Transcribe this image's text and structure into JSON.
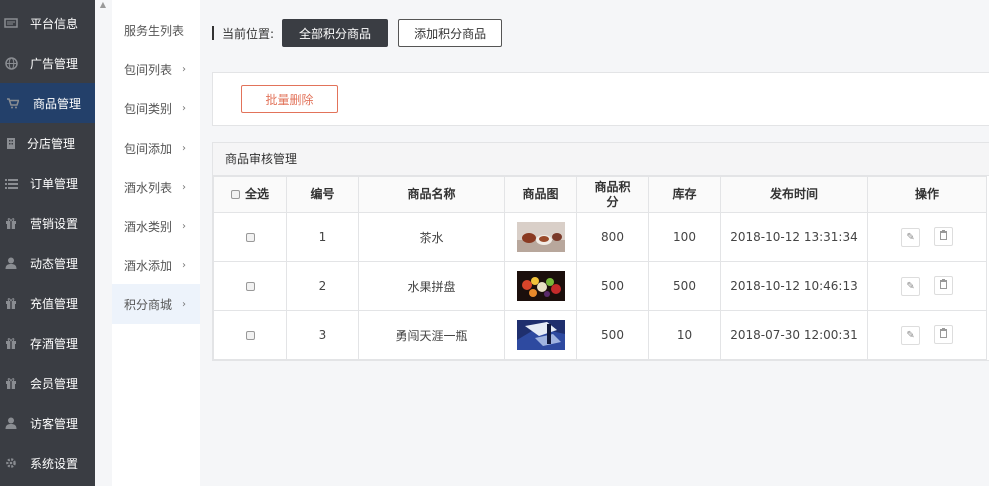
{
  "sidebar": {
    "items": [
      {
        "label": "平台信息",
        "icon": "info-panel-icon"
      },
      {
        "label": "广告管理",
        "icon": "globe-icon"
      },
      {
        "label": "商品管理",
        "icon": "cart-icon",
        "active": true
      },
      {
        "label": "分店管理",
        "icon": "building-icon"
      },
      {
        "label": "订单管理",
        "icon": "list-icon"
      },
      {
        "label": "营销设置",
        "icon": "gift-icon"
      },
      {
        "label": "动态管理",
        "icon": "user-icon"
      },
      {
        "label": "充值管理",
        "icon": "gift-icon"
      },
      {
        "label": "存酒管理",
        "icon": "gift-icon"
      },
      {
        "label": "会员管理",
        "icon": "gift-icon"
      },
      {
        "label": "访客管理",
        "icon": "user-icon"
      },
      {
        "label": "系统设置",
        "icon": "gear-icon"
      }
    ],
    "active_color": "#23406a"
  },
  "submenu": {
    "items": [
      {
        "label": "服务生列表",
        "chevron": false
      },
      {
        "label": "包间列表",
        "chevron": true
      },
      {
        "label": "包间类别",
        "chevron": true
      },
      {
        "label": "包间添加",
        "chevron": true
      },
      {
        "label": "酒水列表",
        "chevron": true
      },
      {
        "label": "酒水类别",
        "chevron": true
      },
      {
        "label": "酒水添加",
        "chevron": true
      },
      {
        "label": "积分商城",
        "chevron": true,
        "active": true
      }
    ],
    "chevron_glyph": "›"
  },
  "breadcrumb": {
    "label": "当前位置:",
    "current_button": "全部积分商品",
    "add_button": "添加积分商品"
  },
  "toolbar": {
    "batch_delete": "批量删除",
    "batch_delete_color": "#e2735a"
  },
  "table": {
    "title": "商品审核管理",
    "select_all": "全选",
    "headers": [
      "编号",
      "商品名称",
      "商品图",
      "商品积分",
      "库存",
      "发布时间",
      "操作"
    ],
    "rows": [
      {
        "id": "1",
        "name": "茶水",
        "image": "tea-photo",
        "points": "800",
        "stock": "100",
        "time": "2018-10-12 13:31:34"
      },
      {
        "id": "2",
        "name": "水果拼盘",
        "image": "fruit-platter-photo",
        "points": "500",
        "stock": "500",
        "time": "2018-10-12 10:46:13"
      },
      {
        "id": "3",
        "name": "勇闯天涯一瓶",
        "image": "beer-bottle-photo",
        "points": "500",
        "stock": "10",
        "time": "2018-07-30 12:00:31"
      }
    ],
    "edit_icon": "pencil-icon",
    "delete_icon": "trash-icon"
  }
}
